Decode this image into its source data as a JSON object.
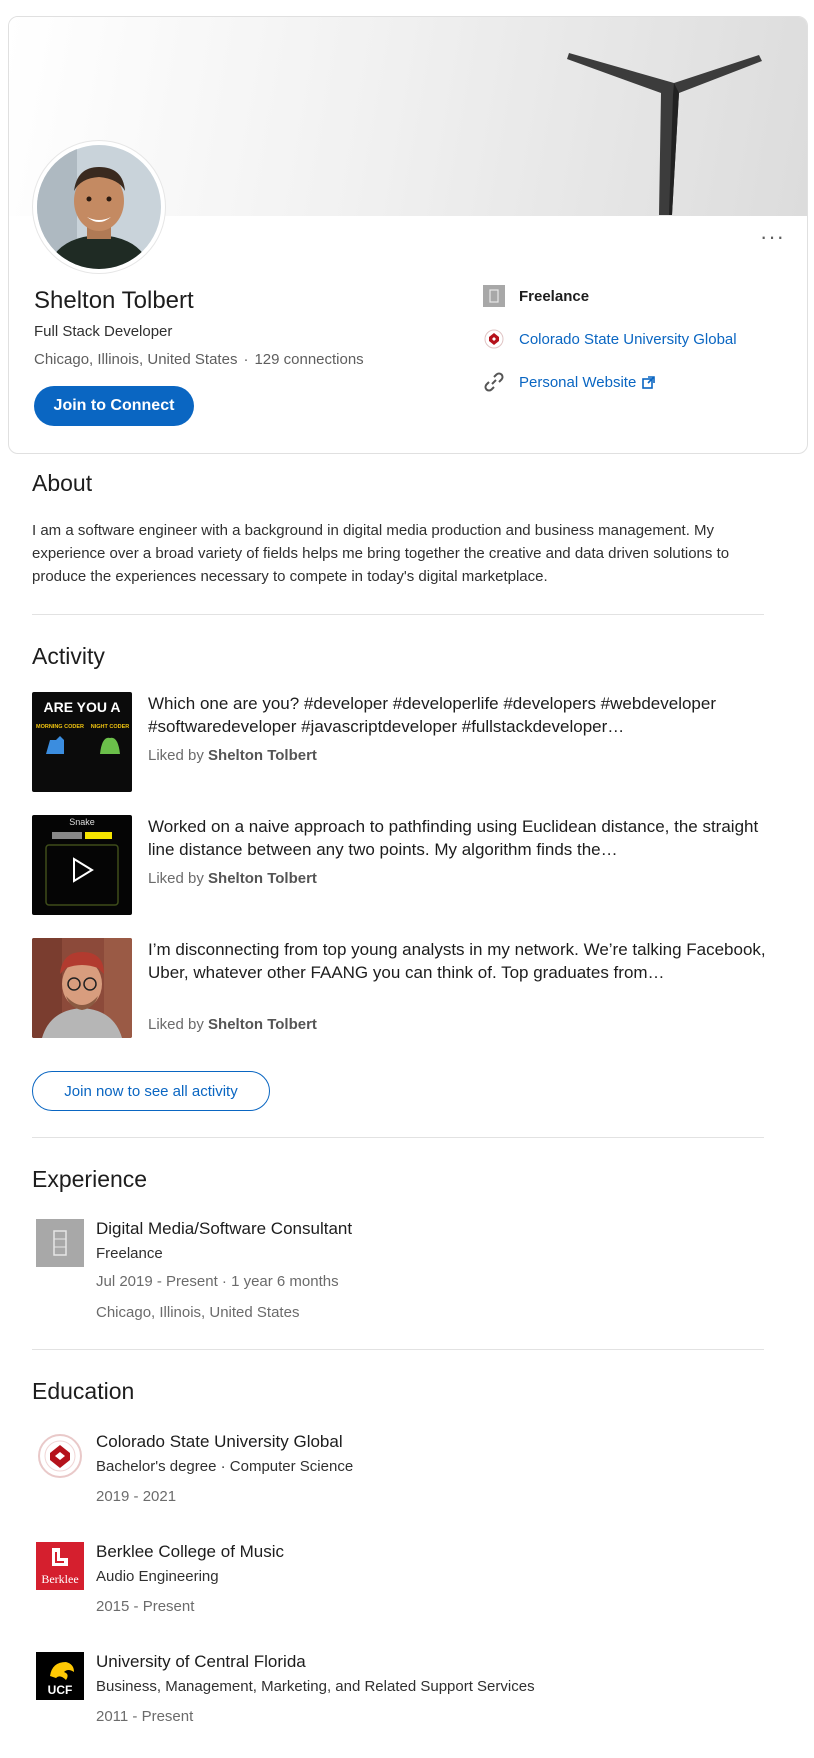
{
  "profile": {
    "name": "Shelton Tolbert",
    "headline": "Full Stack Developer",
    "location": "Chicago, Illinois, United States",
    "separator": "·",
    "connections": "129 connections",
    "join_button": "Join to Connect",
    "more_label": "···",
    "current_company": "Freelance",
    "education_link": "Colorado State University Global",
    "website_link": "Personal Website"
  },
  "about": {
    "heading": "About",
    "text": "I am a software engineer with a background in digital media production and business management. My experience over a broad variety of fields helps me bring together the creative and data driven solutions to produce the experiences necessary to compete in today's digital marketplace."
  },
  "activity": {
    "heading": "Activity",
    "liked_prefix": "Liked by",
    "items": [
      {
        "title": "Which one are you? #developer #developerlife #developers #webdeveloper #softwaredeveloper #javascriptdeveloper #fullstackdeveloper…",
        "liked_by": "Shelton Tolbert",
        "thumb_text": "ARE YOU A",
        "thumb_left": "MORNING CODER",
        "thumb_right": "NIGHT CODER"
      },
      {
        "title": "Worked on a naive approach to pathfinding using Euclidean distance, the straight line distance between any two points. My algorithm finds the…",
        "liked_by": "Shelton Tolbert",
        "thumb_text": "Snake"
      },
      {
        "title": "I’m disconnecting from top young analysts in my network. We’re talking Facebook, Uber, whatever other FAANG you can think of. Top graduates from…",
        "liked_by": "Shelton Tolbert"
      }
    ],
    "see_all_button": "Join now to see all activity"
  },
  "experience": {
    "heading": "Experience",
    "items": [
      {
        "title": "Digital Media/Software Consultant",
        "company": "Freelance",
        "dates": "Jul 2019 - Present · 1 year 6 months",
        "location": "Chicago, Illinois, United States"
      }
    ]
  },
  "education": {
    "heading": "Education",
    "items": [
      {
        "school": "Colorado State University Global",
        "degree": "Bachelor's degree · Computer Science",
        "dates": "2019 - 2021"
      },
      {
        "school": "Berklee College of Music",
        "degree": "Audio Engineering",
        "dates": "2015 - Present",
        "logo_text": "Berklee"
      },
      {
        "school": "University of Central Florida",
        "degree": "Business, Management, Marketing, and Related Support Services",
        "dates": "2011 - Present",
        "logo_text": "UCF"
      }
    ]
  },
  "colors": {
    "brand_blue": "#0a66c2",
    "berklee_red": "#d51f2e",
    "csu_red": "#b5121b"
  },
  "icons": {
    "building": "building-icon",
    "link": "link-icon",
    "external": "external-link-icon",
    "play": "play-icon"
  }
}
